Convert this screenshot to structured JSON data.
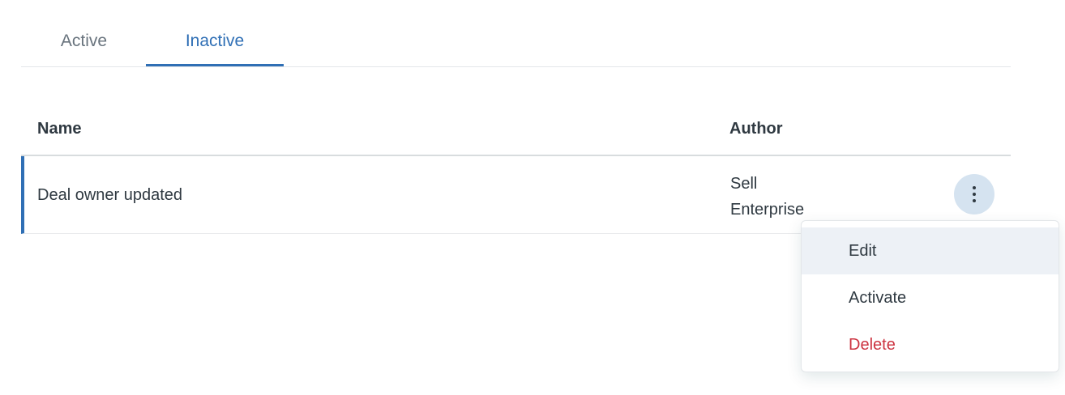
{
  "tabs": [
    {
      "label": "Active",
      "selected": false
    },
    {
      "label": "Inactive",
      "selected": true
    }
  ],
  "table": {
    "columns": [
      "Name",
      "Author"
    ],
    "rows": [
      {
        "name": "Deal owner updated",
        "author_line1": "Sell",
        "author_line2": "Enterprise"
      }
    ]
  },
  "row_menu": {
    "icon": "kebab-vertical-icon",
    "items": [
      {
        "label": "Edit",
        "highlighted": true
      },
      {
        "label": "Activate",
        "highlighted": false
      },
      {
        "label": "Delete",
        "danger": true
      }
    ]
  },
  "colors": {
    "accent": "#2f6fb5",
    "danger": "#cc3340",
    "menu_hover": "#edf1f6",
    "kebab_bg": "#d5e3f0"
  }
}
